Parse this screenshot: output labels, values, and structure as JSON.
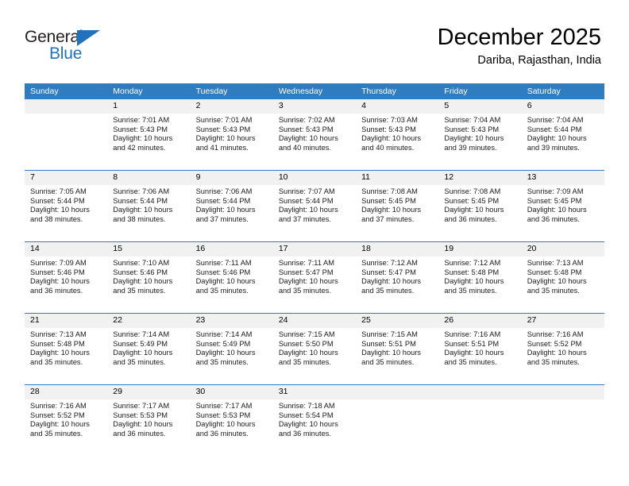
{
  "brand": {
    "name_top": "General",
    "name_bottom": "Blue",
    "accent_color": "#1f72bb"
  },
  "header": {
    "title": "December 2025",
    "subtitle": "Dariba, Rajasthan, India"
  },
  "theme": {
    "header_row_bg": "#2f7cc0",
    "daynum_bg": "#f1f1f1",
    "text_color": "#000000"
  },
  "weekday_headers": [
    "Sunday",
    "Monday",
    "Tuesday",
    "Wednesday",
    "Thursday",
    "Friday",
    "Saturday"
  ],
  "labels": {
    "sunrise_prefix": "Sunrise:",
    "sunset_prefix": "Sunset:",
    "daylight_prefix": "Daylight:"
  },
  "weeks": [
    [
      {
        "day": "",
        "sunrise": "",
        "sunset": "",
        "daylight_line1": "",
        "daylight_line2": "",
        "empty": true
      },
      {
        "day": "1",
        "sunrise": "Sunrise: 7:01 AM",
        "sunset": "Sunset: 5:43 PM",
        "daylight_line1": "Daylight: 10 hours",
        "daylight_line2": "and 42 minutes."
      },
      {
        "day": "2",
        "sunrise": "Sunrise: 7:01 AM",
        "sunset": "Sunset: 5:43 PM",
        "daylight_line1": "Daylight: 10 hours",
        "daylight_line2": "and 41 minutes."
      },
      {
        "day": "3",
        "sunrise": "Sunrise: 7:02 AM",
        "sunset": "Sunset: 5:43 PM",
        "daylight_line1": "Daylight: 10 hours",
        "daylight_line2": "and 40 minutes."
      },
      {
        "day": "4",
        "sunrise": "Sunrise: 7:03 AM",
        "sunset": "Sunset: 5:43 PM",
        "daylight_line1": "Daylight: 10 hours",
        "daylight_line2": "and 40 minutes."
      },
      {
        "day": "5",
        "sunrise": "Sunrise: 7:04 AM",
        "sunset": "Sunset: 5:43 PM",
        "daylight_line1": "Daylight: 10 hours",
        "daylight_line2": "and 39 minutes."
      },
      {
        "day": "6",
        "sunrise": "Sunrise: 7:04 AM",
        "sunset": "Sunset: 5:44 PM",
        "daylight_line1": "Daylight: 10 hours",
        "daylight_line2": "and 39 minutes."
      }
    ],
    [
      {
        "day": "7",
        "sunrise": "Sunrise: 7:05 AM",
        "sunset": "Sunset: 5:44 PM",
        "daylight_line1": "Daylight: 10 hours",
        "daylight_line2": "and 38 minutes."
      },
      {
        "day": "8",
        "sunrise": "Sunrise: 7:06 AM",
        "sunset": "Sunset: 5:44 PM",
        "daylight_line1": "Daylight: 10 hours",
        "daylight_line2": "and 38 minutes."
      },
      {
        "day": "9",
        "sunrise": "Sunrise: 7:06 AM",
        "sunset": "Sunset: 5:44 PM",
        "daylight_line1": "Daylight: 10 hours",
        "daylight_line2": "and 37 minutes."
      },
      {
        "day": "10",
        "sunrise": "Sunrise: 7:07 AM",
        "sunset": "Sunset: 5:44 PM",
        "daylight_line1": "Daylight: 10 hours",
        "daylight_line2": "and 37 minutes."
      },
      {
        "day": "11",
        "sunrise": "Sunrise: 7:08 AM",
        "sunset": "Sunset: 5:45 PM",
        "daylight_line1": "Daylight: 10 hours",
        "daylight_line2": "and 37 minutes."
      },
      {
        "day": "12",
        "sunrise": "Sunrise: 7:08 AM",
        "sunset": "Sunset: 5:45 PM",
        "daylight_line1": "Daylight: 10 hours",
        "daylight_line2": "and 36 minutes."
      },
      {
        "day": "13",
        "sunrise": "Sunrise: 7:09 AM",
        "sunset": "Sunset: 5:45 PM",
        "daylight_line1": "Daylight: 10 hours",
        "daylight_line2": "and 36 minutes."
      }
    ],
    [
      {
        "day": "14",
        "sunrise": "Sunrise: 7:09 AM",
        "sunset": "Sunset: 5:46 PM",
        "daylight_line1": "Daylight: 10 hours",
        "daylight_line2": "and 36 minutes."
      },
      {
        "day": "15",
        "sunrise": "Sunrise: 7:10 AM",
        "sunset": "Sunset: 5:46 PM",
        "daylight_line1": "Daylight: 10 hours",
        "daylight_line2": "and 35 minutes."
      },
      {
        "day": "16",
        "sunrise": "Sunrise: 7:11 AM",
        "sunset": "Sunset: 5:46 PM",
        "daylight_line1": "Daylight: 10 hours",
        "daylight_line2": "and 35 minutes."
      },
      {
        "day": "17",
        "sunrise": "Sunrise: 7:11 AM",
        "sunset": "Sunset: 5:47 PM",
        "daylight_line1": "Daylight: 10 hours",
        "daylight_line2": "and 35 minutes."
      },
      {
        "day": "18",
        "sunrise": "Sunrise: 7:12 AM",
        "sunset": "Sunset: 5:47 PM",
        "daylight_line1": "Daylight: 10 hours",
        "daylight_line2": "and 35 minutes."
      },
      {
        "day": "19",
        "sunrise": "Sunrise: 7:12 AM",
        "sunset": "Sunset: 5:48 PM",
        "daylight_line1": "Daylight: 10 hours",
        "daylight_line2": "and 35 minutes."
      },
      {
        "day": "20",
        "sunrise": "Sunrise: 7:13 AM",
        "sunset": "Sunset: 5:48 PM",
        "daylight_line1": "Daylight: 10 hours",
        "daylight_line2": "and 35 minutes."
      }
    ],
    [
      {
        "day": "21",
        "sunrise": "Sunrise: 7:13 AM",
        "sunset": "Sunset: 5:48 PM",
        "daylight_line1": "Daylight: 10 hours",
        "daylight_line2": "and 35 minutes."
      },
      {
        "day": "22",
        "sunrise": "Sunrise: 7:14 AM",
        "sunset": "Sunset: 5:49 PM",
        "daylight_line1": "Daylight: 10 hours",
        "daylight_line2": "and 35 minutes."
      },
      {
        "day": "23",
        "sunrise": "Sunrise: 7:14 AM",
        "sunset": "Sunset: 5:49 PM",
        "daylight_line1": "Daylight: 10 hours",
        "daylight_line2": "and 35 minutes."
      },
      {
        "day": "24",
        "sunrise": "Sunrise: 7:15 AM",
        "sunset": "Sunset: 5:50 PM",
        "daylight_line1": "Daylight: 10 hours",
        "daylight_line2": "and 35 minutes."
      },
      {
        "day": "25",
        "sunrise": "Sunrise: 7:15 AM",
        "sunset": "Sunset: 5:51 PM",
        "daylight_line1": "Daylight: 10 hours",
        "daylight_line2": "and 35 minutes."
      },
      {
        "day": "26",
        "sunrise": "Sunrise: 7:16 AM",
        "sunset": "Sunset: 5:51 PM",
        "daylight_line1": "Daylight: 10 hours",
        "daylight_line2": "and 35 minutes."
      },
      {
        "day": "27",
        "sunrise": "Sunrise: 7:16 AM",
        "sunset": "Sunset: 5:52 PM",
        "daylight_line1": "Daylight: 10 hours",
        "daylight_line2": "and 35 minutes."
      }
    ],
    [
      {
        "day": "28",
        "sunrise": "Sunrise: 7:16 AM",
        "sunset": "Sunset: 5:52 PM",
        "daylight_line1": "Daylight: 10 hours",
        "daylight_line2": "and 35 minutes."
      },
      {
        "day": "29",
        "sunrise": "Sunrise: 7:17 AM",
        "sunset": "Sunset: 5:53 PM",
        "daylight_line1": "Daylight: 10 hours",
        "daylight_line2": "and 36 minutes."
      },
      {
        "day": "30",
        "sunrise": "Sunrise: 7:17 AM",
        "sunset": "Sunset: 5:53 PM",
        "daylight_line1": "Daylight: 10 hours",
        "daylight_line2": "and 36 minutes."
      },
      {
        "day": "31",
        "sunrise": "Sunrise: 7:18 AM",
        "sunset": "Sunset: 5:54 PM",
        "daylight_line1": "Daylight: 10 hours",
        "daylight_line2": "and 36 minutes."
      },
      {
        "day": "",
        "sunrise": "",
        "sunset": "",
        "daylight_line1": "",
        "daylight_line2": "",
        "empty": true
      },
      {
        "day": "",
        "sunrise": "",
        "sunset": "",
        "daylight_line1": "",
        "daylight_line2": "",
        "empty": true
      },
      {
        "day": "",
        "sunrise": "",
        "sunset": "",
        "daylight_line1": "",
        "daylight_line2": "",
        "empty": true
      }
    ]
  ]
}
